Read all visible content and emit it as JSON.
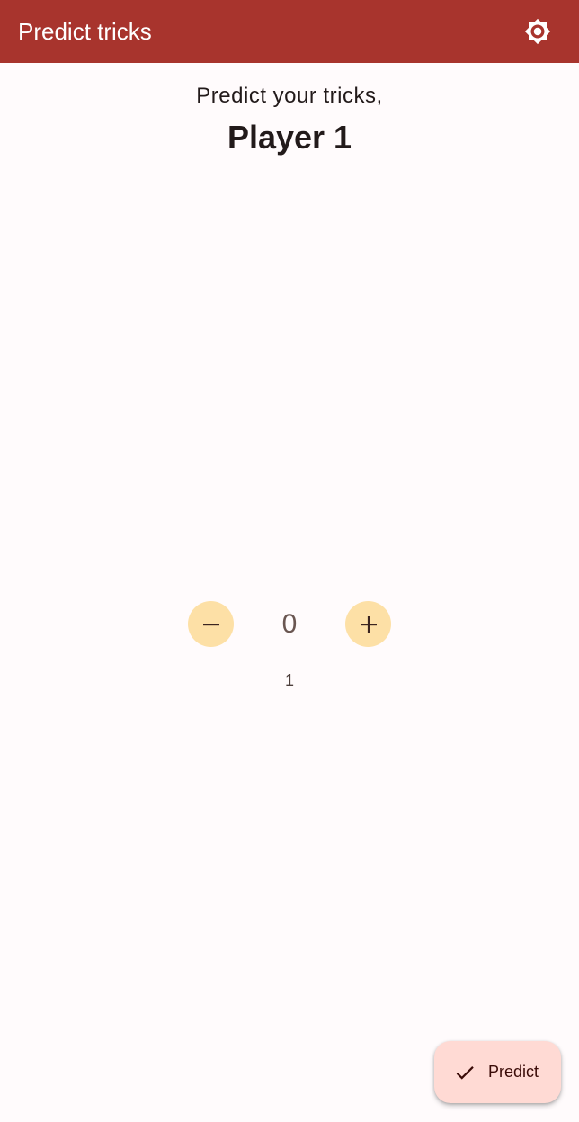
{
  "app_bar": {
    "title": "Predict tricks",
    "background": "#a8342d",
    "settings_icon": "brightness-gear-icon"
  },
  "main": {
    "prompt": "Predict your tricks,",
    "player_name": "Player 1"
  },
  "stepper": {
    "value": "0",
    "minus_icon": "minus-icon",
    "plus_icon": "plus-icon",
    "button_color": "#fde0a6"
  },
  "sub_value": "1",
  "fab": {
    "label": "Predict",
    "icon": "check-icon",
    "background": "#ffdad4"
  }
}
